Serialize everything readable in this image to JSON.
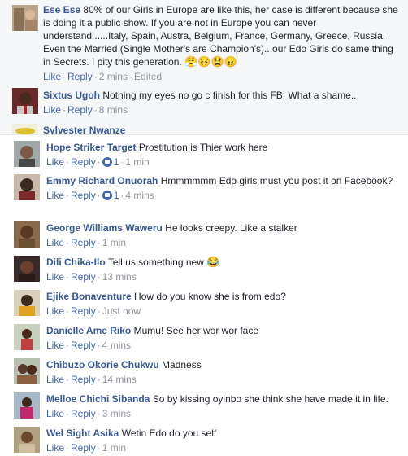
{
  "top_comments": [
    {
      "name": "Ese Ese",
      "text": "80% of our Girls in Europe are like this, her case is different because she is doing it a public show. If you are not in Europe you can never understand......Italy, Spain, Austra, Belgium, France, Germany, Greece, Russia. Even the Married (Single Mother's are Champion's)...our Edo Girls do same thing in Secrets. I pity this generation.",
      "emoji": "😤😣😫😠",
      "like": "Like",
      "reply": "Reply",
      "time": "2 mins",
      "edited": "Edited"
    },
    {
      "name": "Sixtus Ugoh",
      "text": "Nothing my eyes no go c finish for this FB. What a shame..",
      "like": "Like",
      "reply": "Reply",
      "time": "8 mins"
    },
    {
      "name": "Sylvester Nwanze"
    }
  ],
  "comments": [
    {
      "name": "Hope Striker Target",
      "text": "Prostitution is Thier work here",
      "like": "Like",
      "reply": "Reply",
      "reactions": "1",
      "time": "1 min"
    },
    {
      "name": "Emmy Richard Onuorah",
      "text": "Hmmmmmm Edo girls must you post it on Facebook?",
      "like": "Like",
      "reply": "Reply",
      "reactions": "1",
      "time": "4 mins"
    },
    {
      "name": "George Williams Waweru",
      "text": "He looks creepy. Like a stalker",
      "like": "Like",
      "reply": "Reply",
      "time": "1 min"
    },
    {
      "name": "Dili Chika-Ilo",
      "text": "Tell us something new",
      "emoji": "😂",
      "like": "Like",
      "reply": "Reply",
      "time": "13 mins"
    },
    {
      "name": "Ejike Bonaventure",
      "text": "How do you know she is from edo?",
      "like": "Like",
      "reply": "Reply",
      "time": "Just now"
    },
    {
      "name": "Danielle Ame Riko",
      "text": "Mumu! See her wor wor face",
      "like": "Like",
      "reply": "Reply",
      "time": "4 mins"
    },
    {
      "name": "Chibuzo Okorie Chukwu",
      "text": "Madness",
      "like": "Like",
      "reply": "Reply",
      "time": "14 mins"
    },
    {
      "name": "Melloe Chichi Sibanda",
      "text": "So by kissing oyinbo she think she have made it in life.",
      "like": "Like",
      "reply": "Reply",
      "time": "3 mins"
    },
    {
      "name": "Wel Sight Asika",
      "text": "Wetin Edo do you self",
      "like": "Like",
      "reply": "Reply",
      "time": "1 min"
    }
  ],
  "colors": {
    "name": "#365899",
    "link": "#4267b2",
    "meta": "#90949c",
    "card_bg": "#f6f7f9"
  }
}
